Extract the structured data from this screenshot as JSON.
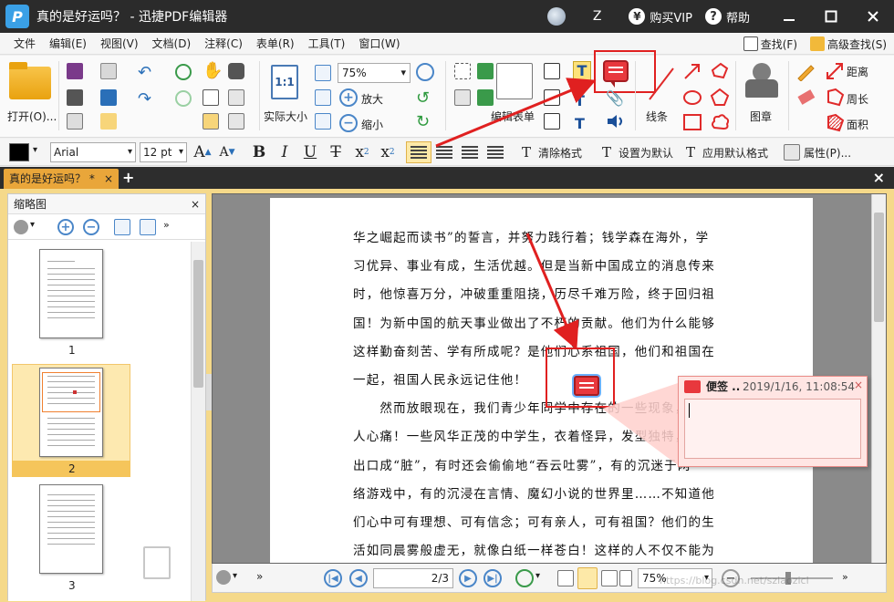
{
  "window": {
    "title": "真的是好运吗？ - 迅捷PDF编辑器",
    "logo_letter": "P",
    "user_initial": "Z",
    "vip_label": "购买VIP",
    "help_label": "帮助",
    "vip_symbol": "¥",
    "help_symbol": "?"
  },
  "menu": {
    "items": [
      "文件",
      "编辑(E)",
      "视图(V)",
      "文档(D)",
      "注释(C)",
      "表单(R)",
      "工具(T)",
      "窗口(W)"
    ],
    "find": "查找(F)",
    "advanced_find": "高级查找(S)"
  },
  "toolbar": {
    "open": "打开(O)...",
    "actual_size": "实际大小",
    "one_to_one": "1:1",
    "zoom": "75%",
    "zoom_in": "放大",
    "zoom_out": "缩小",
    "edit_form": "编辑表单",
    "line": "线条",
    "stamp": "图章",
    "distance": "距离",
    "perimeter": "周长",
    "area": "面积"
  },
  "format": {
    "font": "Arial",
    "size": "12 pt",
    "clear_format": "清除格式",
    "set_default": "设置为默认",
    "apply_default": "应用默认格式",
    "properties": "属性(P)..."
  },
  "tabs": {
    "doc_tab": "真的是好运吗？ *",
    "close": "×",
    "plus": "+"
  },
  "thumbnails": {
    "title": "缩略图",
    "pages": [
      "1",
      "2",
      "3"
    ]
  },
  "document": {
    "lines": [
      "华之崛起而读书”的誓言，并努力践行着；钱学森在海外，学",
      "习优异、事业有成，生活优越。但是当新中国成立的消息传来",
      "时，他惊喜万分，冲破重重阻挠，历尽千难万险，终于回归祖",
      "国！为新中国的航天事业做出了不朽的贡献。他们为什么能够",
      "这样勤奋刻苦、学有所成呢？是他们心系祖国，他们和祖国在",
      "一起，祖国人民永远记住他！",
      "　　然而放眼现在，我们青少年同学中存在的一些现象，实在令",
      "人心痛！一些风华正茂的中学生，衣着怪异，发型独特，时常",
      "出口成“脏”，有时还会偷偷地“吞云吐雾”，有的沉迷于网",
      "络游戏中，有的沉浸在言情、魔幻小说的世界里……不知道他",
      "们心中可有理想、可有信念；可有亲人，可有祖国？他们的生",
      "活如同晨雾般虚无，就像白纸一样苍白！这样的人不仅不能为"
    ]
  },
  "sticky_note": {
    "label": "便签 ..",
    "date": "2019/1/16, 11:08:54",
    "close": "×"
  },
  "status": {
    "page": "2/3",
    "zoom": "75%",
    "watermark": "https://blog.csdn.net/szlaozicl"
  },
  "colors": {
    "note_red": "#e8383d",
    "highlight_box": "#e02020",
    "tab_accent": "#e9a63a"
  }
}
